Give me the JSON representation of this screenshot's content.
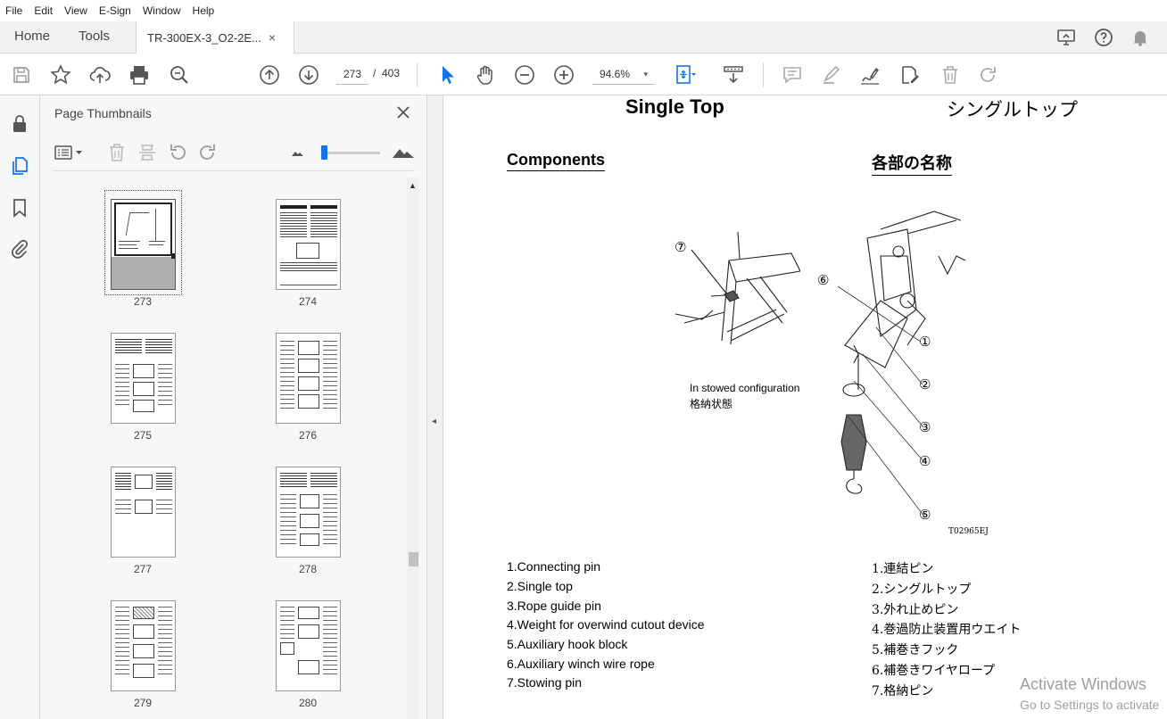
{
  "menu": [
    "File",
    "Edit",
    "View",
    "E-Sign",
    "Window",
    "Help"
  ],
  "tabs": {
    "home": "Home",
    "tools": "Tools",
    "document": "TR-300EX-3_O2-2E...",
    "close": "×"
  },
  "toolbar": {
    "current_page": "273",
    "page_sep": "/",
    "total_pages": "403",
    "zoom": "94.6%",
    "zoom_caret": "▾"
  },
  "panel": {
    "title": "Page Thumbnails",
    "scroll_up": "▲",
    "thumbnails": [
      {
        "label": "273",
        "selected": true
      },
      {
        "label": "274"
      },
      {
        "label": "275"
      },
      {
        "label": "276"
      },
      {
        "label": "277"
      },
      {
        "label": "278"
      },
      {
        "label": "279"
      },
      {
        "label": "280"
      }
    ]
  },
  "splitter_arrow": "◂",
  "document": {
    "title_en": "Single Top",
    "title_ja": "シングルトップ",
    "section_en": "Components",
    "section_ja": "各部の名称",
    "caption_en": "In stowed configuration",
    "caption_ja": "格納状態",
    "figure_code": "T02965EJ",
    "callouts": [
      "⑦",
      "⑥",
      "①",
      "②",
      "③",
      "④",
      "⑤"
    ],
    "list_en": [
      "1.Connecting pin",
      "2.Single top",
      "3.Rope guide pin",
      "4.Weight for overwind cutout device",
      "5.Auxiliary hook block",
      "6.Auxiliary winch wire rope",
      "7.Stowing pin"
    ],
    "list_ja": [
      "1.連結ピン",
      "2.シングルトップ",
      "3.外れ止めピン",
      "4.巻過防止装置用ウエイト",
      "5.補巻きフック",
      "6.補巻きワイヤロープ",
      "7.格納ピン"
    ]
  },
  "watermark": {
    "line1": "Activate Windows",
    "line2": "Go to Settings to activate"
  },
  "colors": {
    "accent": "#1473e6",
    "selection_gray": "#b0b0b0"
  }
}
